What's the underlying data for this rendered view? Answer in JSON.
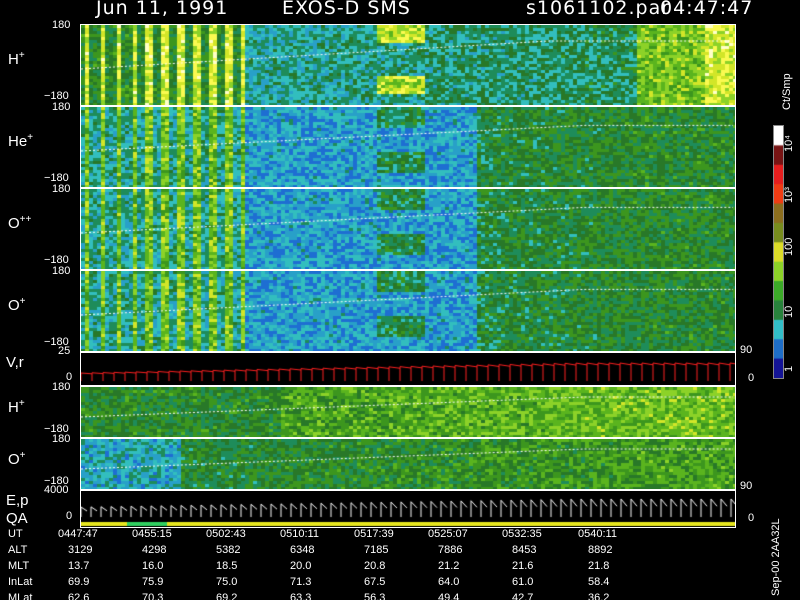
{
  "header": {
    "date": "Jun 11, 1991",
    "instrument": "EXOS-D SMS",
    "file": "s1061102.par",
    "time": "04:47:47"
  },
  "panels": [
    {
      "id": "h",
      "label": "H",
      "sup": "+",
      "ymax": "180",
      "ymin": "−180"
    },
    {
      "id": "he",
      "label": "He",
      "sup": "+",
      "ymax": "180",
      "ymin": "−180"
    },
    {
      "id": "opp",
      "label": "O",
      "sup": "++",
      "ymax": "180",
      "ymin": "−180"
    },
    {
      "id": "o",
      "label": "O",
      "sup": "+",
      "ymax": "180",
      "ymin": "−180"
    },
    {
      "id": "vr",
      "label": "V,r",
      "sup": "",
      "ymax": "25",
      "ymin": "0",
      "rmax": "90",
      "rmin": "0"
    },
    {
      "id": "h2",
      "label": "H",
      "sup": "+",
      "ymax": "180",
      "ymin": "−180"
    },
    {
      "id": "o2",
      "label": "O",
      "sup": "+",
      "ymax": "180",
      "ymin": "−180",
      "rmax": "90",
      "rmin": "0"
    },
    {
      "id": "ep",
      "label": "E,p",
      "sup": "",
      "label2": "QA",
      "ymax": "4000",
      "ymin": "0",
      "rmin": "0"
    }
  ],
  "colorbar": {
    "unit": "Ct/Smp",
    "ticks": [
      "10⁴",
      "10³",
      "100",
      "10",
      "1"
    ]
  },
  "colors": {
    "background": "#000000",
    "low": "#000080",
    "mid": "#2eb8c8",
    "high": "#3aa020",
    "peak": "#ffff60",
    "max": "#ffffff",
    "vr_trace": "#ff2020"
  },
  "footer": {
    "rows": [
      {
        "name": "UT",
        "values": [
          "0447:47",
          "0455:15",
          "0502:43",
          "0510:11",
          "0517:39",
          "0525:07",
          "0532:35",
          "0540:11"
        ]
      },
      {
        "name": "ALT",
        "values": [
          "3129",
          "4298",
          "5382",
          "6348",
          "7185",
          "7886",
          "8453",
          "8892"
        ]
      },
      {
        "name": "MLT",
        "values": [
          "13.7",
          "16.0",
          "18.5",
          "20.0",
          "20.8",
          "21.2",
          "21.6",
          "21.8"
        ]
      },
      {
        "name": "InLat",
        "values": [
          "69.9",
          "75.9",
          "75.0",
          "71.3",
          "67.5",
          "64.0",
          "61.0",
          "58.4"
        ]
      },
      {
        "name": "MLat",
        "values": [
          "62.6",
          "70.3",
          "69.2",
          "63.3",
          "56.3",
          "49.4",
          "42.7",
          "36.2"
        ]
      }
    ],
    "stamp": "Sep-00 2AA32L"
  },
  "chart_data": {
    "type": "heatmap",
    "title": "Jun 11, 1991   EXOS-D SMS",
    "x_label": "UT",
    "x_ticks": [
      "0447:47",
      "0455:15",
      "0502:43",
      "0510:11",
      "0517:39",
      "0525:07",
      "0532:35",
      "0540:11"
    ],
    "series": [
      {
        "name": "H+",
        "ylim": [
          -180,
          180
        ]
      },
      {
        "name": "He+",
        "ylim": [
          -180,
          180
        ]
      },
      {
        "name": "O++",
        "ylim": [
          -180,
          180
        ]
      },
      {
        "name": "O+",
        "ylim": [
          -180,
          180
        ]
      },
      {
        "name": "V,r",
        "ylim": [
          0,
          25
        ],
        "right_ylim": [
          0,
          90
        ]
      },
      {
        "name": "H+",
        "ylim": [
          -180,
          180
        ]
      },
      {
        "name": "O+",
        "ylim": [
          -180,
          180
        ],
        "right_ylim": [
          0,
          90
        ]
      },
      {
        "name": "E,p",
        "ylim": [
          0,
          4000
        ]
      }
    ],
    "colorbar": {
      "label": "Ct/Smp",
      "range": [
        1,
        10000
      ],
      "scale": "log"
    }
  }
}
